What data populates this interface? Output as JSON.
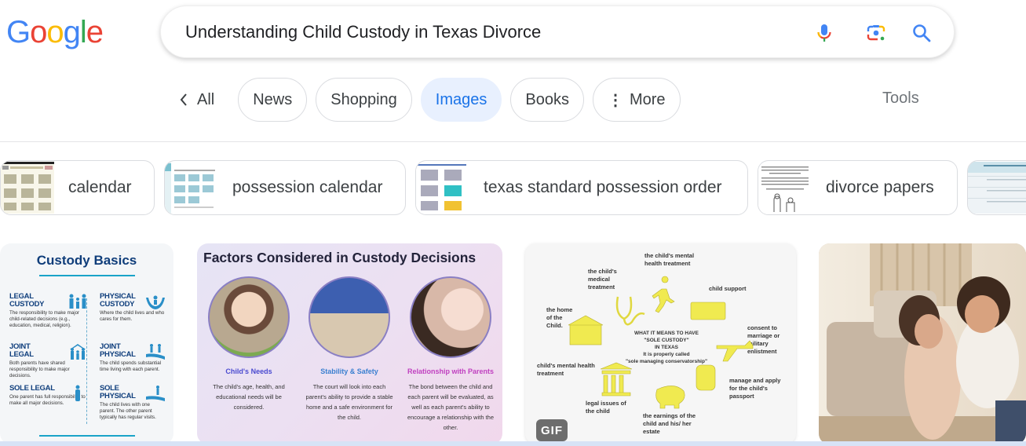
{
  "logo": {
    "text": "Google",
    "letters": [
      {
        "ch": "G",
        "color": "#4285F4"
      },
      {
        "ch": "o",
        "color": "#EA4335"
      },
      {
        "ch": "o",
        "color": "#FBBC05"
      },
      {
        "ch": "g",
        "color": "#4285F4"
      },
      {
        "ch": "l",
        "color": "#34A853"
      },
      {
        "ch": "e",
        "color": "#EA4335"
      }
    ]
  },
  "search": {
    "query": "Understanding Child Custody in Texas Divorce",
    "icons": [
      "microphone-icon",
      "lens-camera-icon",
      "search-icon"
    ]
  },
  "tabs": {
    "back_label": "All",
    "items": [
      {
        "label": "News",
        "active": false
      },
      {
        "label": "Shopping",
        "active": false
      },
      {
        "label": "Images",
        "active": true
      },
      {
        "label": "Books",
        "active": false
      },
      {
        "label": "More",
        "active": false
      }
    ],
    "tools_label": "Tools"
  },
  "colors": {
    "accent": "#1a73e8",
    "active_tab_bg": "#e8f0fe",
    "chip_border": "#dadce0",
    "muted_text": "#70757a"
  },
  "related_searches": [
    {
      "label": "calendar"
    },
    {
      "label": "possession calendar"
    },
    {
      "label": "texas standard possession order"
    },
    {
      "label": "divorce papers"
    },
    {
      "label": ""
    }
  ],
  "images": {
    "card1": {
      "title": "Custody Basics",
      "blocks": [
        {
          "head": "LEGAL CUSTODY",
          "desc": "The responsibility to make major child-related decisions (e.g., education, medical, religion)."
        },
        {
          "head": "PHYSICAL CUSTODY",
          "desc": "Where the child lives and who cares for them."
        },
        {
          "head": "JOINT LEGAL",
          "desc": "Both parents have shared responsibility to make major decisions."
        },
        {
          "head": "JOINT PHYSICAL",
          "desc": "The child spends substantial time living with each parent."
        },
        {
          "head": "SOLE LEGAL",
          "desc": "One parent has full responsibility to make all major decisions."
        },
        {
          "head": "SOLE PHYSICAL",
          "desc": "The child lives with one parent. The other parent typically has regular visits."
        }
      ]
    },
    "card2": {
      "title": "Factors Considered in Custody Decisions",
      "columns": [
        {
          "sub": "Child's Needs",
          "color": "#4a4ad0",
          "desc": "The child's age, health, and educational needs will be considered."
        },
        {
          "sub": "Stability & Safety",
          "color": "#3a7fd0",
          "desc": "The court will look into each parent's ability to provide a stable home and a safe environment for the child."
        },
        {
          "sub": "Relationship with Parents",
          "color": "#c040c0",
          "desc": "The bond between the child and each parent will be evaluated, as well as each parent's ability to encourage a relationship with the other."
        }
      ]
    },
    "card3": {
      "center_lines": [
        "WHAT IT MEANS TO HAVE",
        "\"SOLE CUSTODY\"",
        "IN TEXAS",
        "It is properly called",
        "\"sole managing conservatorship\""
      ],
      "labels": [
        "the child's mental health treatment",
        "the child's medical treatment",
        "child support",
        "the home of the Child.",
        "consent to marriage or military enlistment",
        "child's mental health treatment",
        "manage and apply for the child's passport",
        "legal issues of the child",
        "the earnings of the child and his/ her estate"
      ],
      "badge": "GIF"
    },
    "card4": {
      "alt": "mother kissing smiling child in living room"
    }
  }
}
